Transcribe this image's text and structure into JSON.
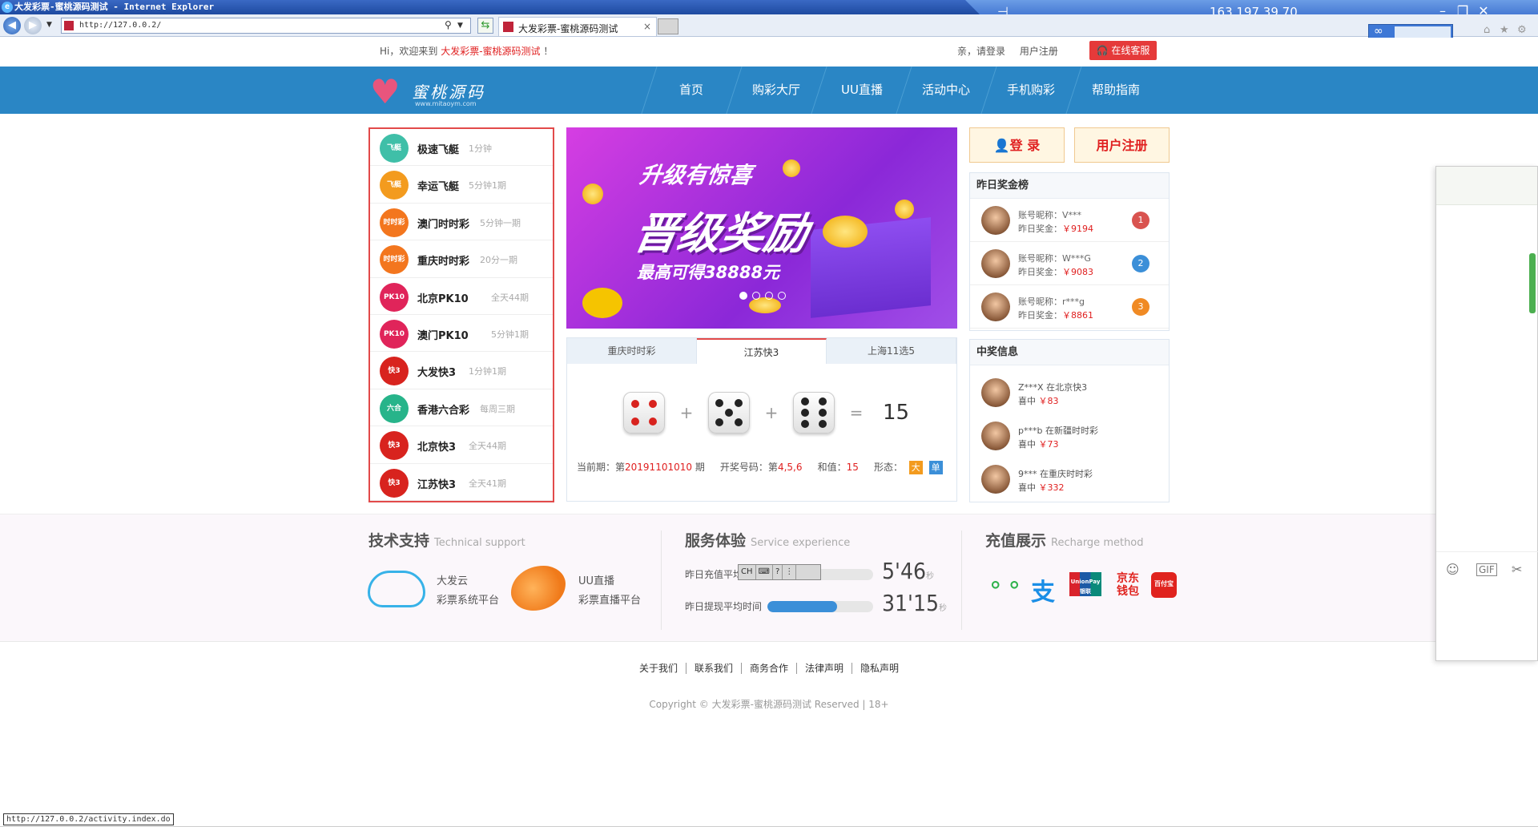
{
  "window": {
    "title": "大发彩票-蜜桃源码测试 - Internet Explorer",
    "remote_ip": "163.197.39.70",
    "pin": "⊣",
    "min": "–",
    "restore": "❐",
    "close": "✕"
  },
  "browser": {
    "url": "http://127.0.0.2/",
    "tab_title": "大发彩票-蜜桃源码测试",
    "tab_close": "×",
    "status_url": "http://127.0.0.2/activity.index.do",
    "baidu_logo": "∞"
  },
  "topbar": {
    "welcome_prefix": "Hi，欢迎来到",
    "site_name": "大发彩票-蜜桃源码测试",
    "welcome_suffix": "！",
    "login_prompt": "亲，请登录",
    "register": "用户注册",
    "online_service": "在线客服"
  },
  "logo": {
    "text": "蜜桃源码",
    "sub": "www.mitaoym.com"
  },
  "nav": [
    "首页",
    "购彩大厅",
    "UU直播",
    "活动中心",
    "手机购彩",
    "帮助指南"
  ],
  "lotteries": [
    {
      "name": "极速飞艇",
      "period": "1分钟",
      "icon": "飞艇",
      "color": "#3fbfa8"
    },
    {
      "name": "幸运飞艇",
      "period": "5分钟1期",
      "icon": "飞艇",
      "color": "#f39b1e"
    },
    {
      "name": "澳门时时彩",
      "period": "5分钟一期",
      "icon": "时时彩",
      "color": "#f3761e"
    },
    {
      "name": "重庆时时彩",
      "period": "20分一期",
      "icon": "时时彩",
      "color": "#f3761e"
    },
    {
      "name": "北京PK10",
      "period": "全天44期",
      "icon": "PK10",
      "color": "#e0245a"
    },
    {
      "name": "澳门PK10",
      "period": "5分钟1期",
      "icon": "PK10",
      "color": "#e0245a"
    },
    {
      "name": "大发快3",
      "period": "1分钟1期",
      "icon": "快3",
      "color": "#d8231e"
    },
    {
      "name": "香港六合彩",
      "period": "每周三期",
      "icon": "六合",
      "color": "#27b48a"
    },
    {
      "name": "北京快3",
      "period": "全天44期",
      "icon": "快3",
      "color": "#d8231e"
    },
    {
      "name": "江苏快3",
      "period": "全天41期",
      "icon": "快3",
      "color": "#d8231e"
    }
  ],
  "banner": {
    "line1": "升级有惊喜",
    "line2": "晋级奖励",
    "line3": "最高可得38888元",
    "slides": 4,
    "active_slide": 1
  },
  "draw": {
    "tabs": [
      "重庆时时彩",
      "江苏快3",
      "上海11选5"
    ],
    "active_tab": 1,
    "dice": [
      4,
      5,
      6
    ],
    "plus": "+",
    "equals": "=",
    "sum": "15",
    "issue_label": "当前期：第",
    "issue": "20191101010",
    "issue_suffix": "期",
    "open_label": "开奖号码：第",
    "open_numbers": "4,5,6",
    "sum_label": "和值：",
    "sum_value": "15",
    "shape_label": "形态：",
    "size": "大",
    "parity": "单"
  },
  "auth": {
    "login": "登 录",
    "register": "用户注册"
  },
  "rank": {
    "title": "昨日奖金榜",
    "items": [
      {
        "account": "账号昵称：V***",
        "prize_label": "昨日奖金：",
        "prize": "￥9194",
        "rank": "1",
        "color": "#d9534f"
      },
      {
        "account": "账号昵称：W***G",
        "prize_label": "昨日奖金：",
        "prize": "￥9083",
        "rank": "2",
        "color": "#3b8fd8"
      },
      {
        "account": "账号昵称：r***g",
        "prize_label": "昨日奖金：",
        "prize": "￥8861",
        "rank": "3",
        "color": "#f08a24"
      }
    ]
  },
  "wins": {
    "title": "中奖信息",
    "items": [
      {
        "text": "Z***X 在北京快3",
        "label": "喜中",
        "amount": "￥83"
      },
      {
        "text": "p***b 在新疆时时彩",
        "label": "喜中",
        "amount": "￥73"
      },
      {
        "text": "9*** 在重庆时时彩",
        "label": "喜中",
        "amount": "￥332"
      }
    ]
  },
  "support": {
    "title": "技术支持",
    "title_en": "Technical support",
    "a1": "大发云",
    "a2": "彩票系统平台",
    "b1": "UU直播",
    "b2": "彩票直播平台"
  },
  "service": {
    "title": "服务体验",
    "title_en": "Service experience",
    "r1_label": "昨日充值平均时间",
    "r1_min": "5",
    "r1_sec": "46",
    "r1_unit": "秒",
    "r1_fill": 0.42,
    "r2_label": "昨日提现平均时间",
    "r2_min": "31",
    "r2_sec": "15",
    "r2_unit": "秒",
    "r2_fill": 0.66
  },
  "ime": {
    "cn": "CH",
    "help": "?"
  },
  "recharge": {
    "title": "充值展示",
    "title_en": "Recharge method",
    "wechat": "微信",
    "alipay": "支",
    "unionpay": "UnionPay 银联",
    "jd": "京东钱包",
    "baifu": "百付宝"
  },
  "footer": {
    "links": [
      "关于我们",
      "联系我们",
      "商务合作",
      "法律声明",
      "隐私声明"
    ],
    "copyright": "Copyright © 大发彩票-蜜桃源码测试 Reserved | 18+"
  },
  "chat": {
    "emoji": "☺",
    "gif": "GIF",
    "cut": "✂"
  }
}
